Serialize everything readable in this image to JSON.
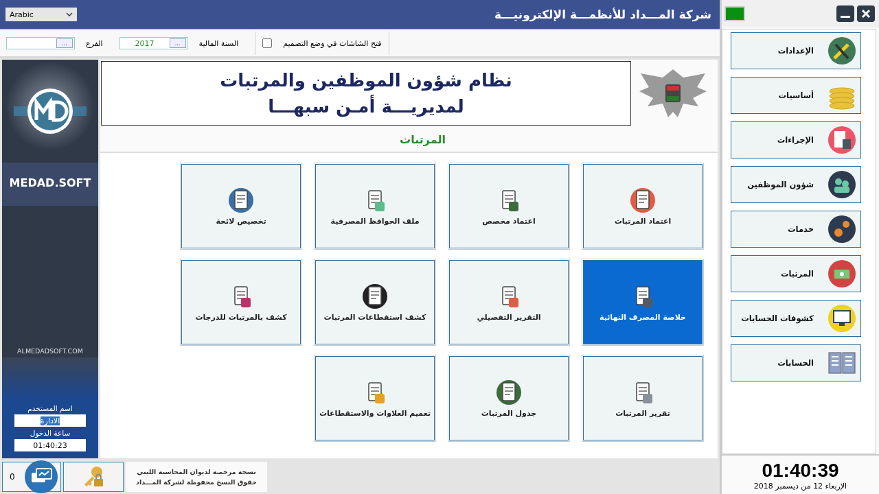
{
  "language_select": {
    "value": "Arabic"
  },
  "window": {
    "title": "شركة المـــداد للأنظمـــة الإلكترونيـــة"
  },
  "toolbar": {
    "branch": {
      "label": "الفرع",
      "browse": "..."
    },
    "fiscal_year": {
      "label": "السنة المالية",
      "value": "2017",
      "browse": "..."
    },
    "design_mode": {
      "label": "فتح الشاشات في وضع التصميم",
      "checked": false
    }
  },
  "brand_panel": {
    "name": "MEDAD.SOFT",
    "website": "ALMEDADSOFT.COM"
  },
  "user": {
    "name_label": "اسم المستخدم",
    "name_value": "الادارة",
    "login_label": "ساعة الدخول",
    "login_value": "01:40:23"
  },
  "banner": {
    "line_1": "نظام شؤون الموظفين والمرتبات",
    "line_2": "لمديريـــة أمـن سبهـــا"
  },
  "section_title": "المرتبات",
  "tiles": [
    {
      "label": "اعتماد المرتبات",
      "selected": false
    },
    {
      "label": "اعتماد مخصص",
      "selected": false
    },
    {
      "label": "ملف الحوافظ المصرفية",
      "selected": false
    },
    {
      "label": "تخصيص لائحة",
      "selected": false
    },
    {
      "label": "خلاصة المصرف النهائية",
      "selected": true
    },
    {
      "label": "التقرير التفصيلي",
      "selected": false
    },
    {
      "label": "كشف استقطاعات المرتبات",
      "selected": false
    },
    {
      "label": "كشف بالمرتبات للدرجات",
      "selected": false
    },
    {
      "label": "تقرير المرتبات",
      "selected": false
    },
    {
      "label": "جدول المرتبات",
      "selected": false
    },
    {
      "label": "تعميم العلاوات والاستقطاعات",
      "selected": false
    }
  ],
  "nav": [
    {
      "label": "الإعدادات"
    },
    {
      "label": "أساسيات"
    },
    {
      "label": "الإجراءات"
    },
    {
      "label": "شؤون الموظفين"
    },
    {
      "label": "خدمات"
    },
    {
      "label": "المرتبات"
    },
    {
      "label": "كشوفات الحسابات"
    },
    {
      "label": "الحسابات"
    }
  ],
  "status_bar": {
    "count": "0",
    "license_line_1": "نسخة مرخصة لديوان المحاسبة الليبي",
    "license_line_2": "حقوق النسخ محفوظة لشركة المـــداد"
  },
  "clock": {
    "time": "01:40:39",
    "date": "الإربعاء 12 من ديسمبر 2018"
  }
}
